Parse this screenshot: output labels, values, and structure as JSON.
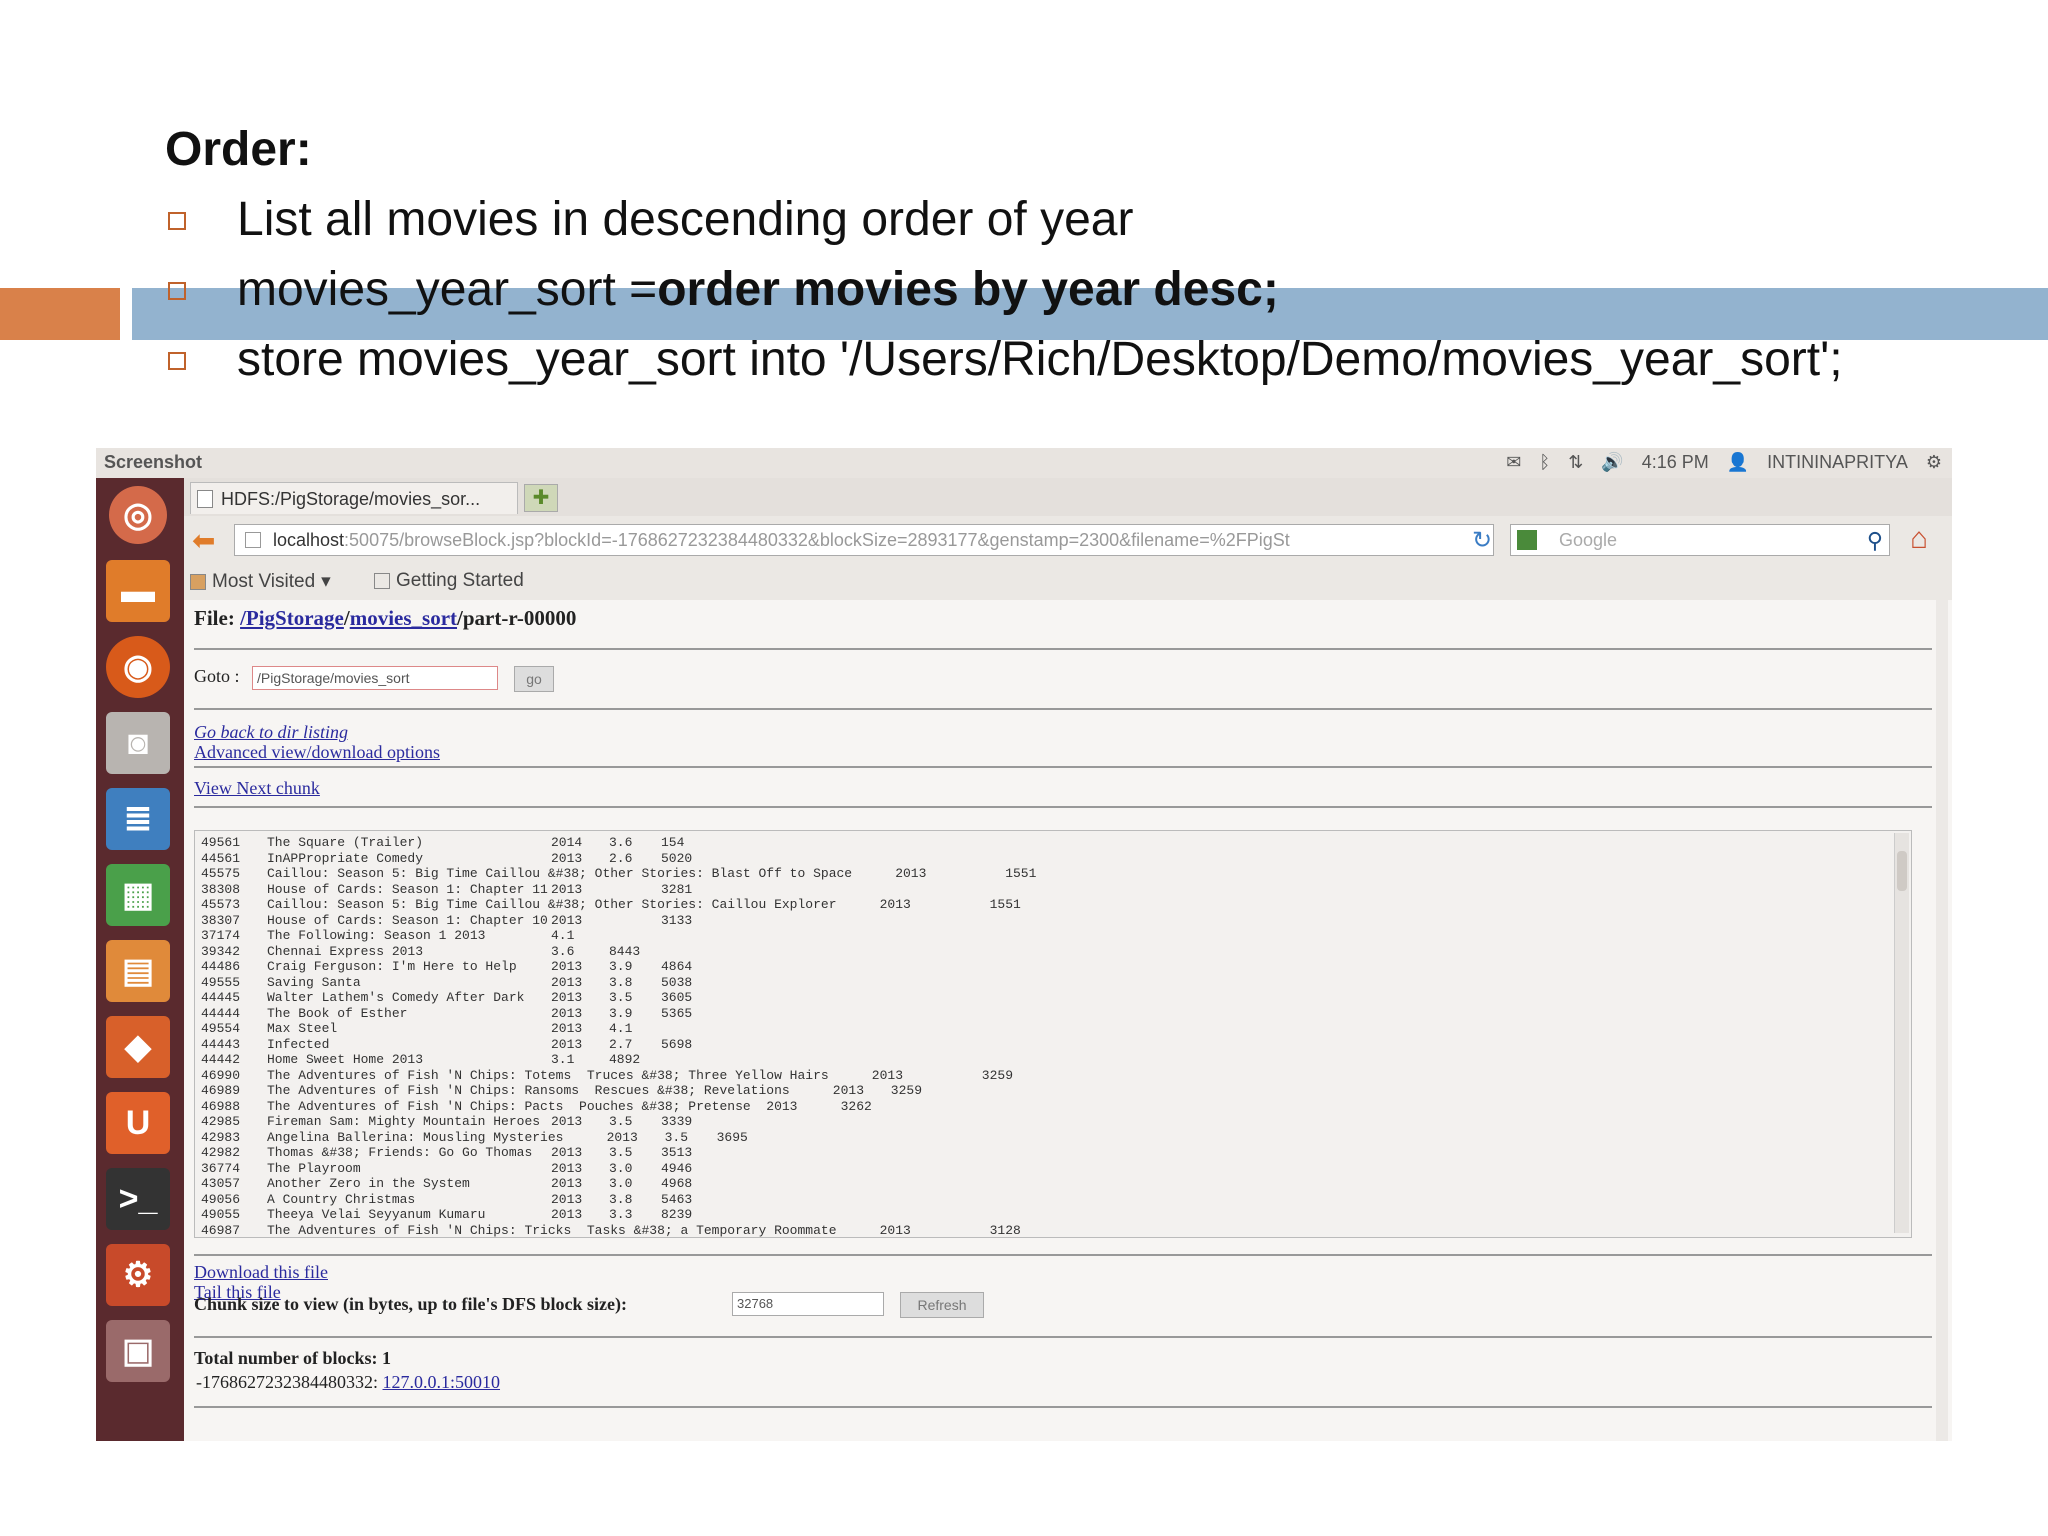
{
  "slide": {
    "heading": "Order:",
    "bullets": [
      {
        "text": "List all movies in descending order of year"
      },
      {
        "prefix": "movies_year_sort =",
        "bold": "order movies by year desc;"
      },
      {
        "text": "store movies_year_sort into '/Users/Rich/Desktop/Demo/movies_year_sort';"
      }
    ]
  },
  "top_panel": {
    "title": "Screenshot",
    "time": "4:16 PM",
    "user": "INTININAPRITYA"
  },
  "browser": {
    "tab_title": "HDFS:/PigStorage/movies_sor...",
    "url_host": "localhost",
    "url_rest": ":50075/browseBlock.jsp?blockId=-1768627232384480332&blockSize=2893177&genstamp=2300&filename=%2FPigSt",
    "search_placeholder": "Google",
    "bookmarks": [
      "Most Visited",
      "Getting Started"
    ]
  },
  "page": {
    "file_label": "File:",
    "file_path_1": "/PigStorage",
    "file_path_sep": "/",
    "file_path_2": "movies_sort",
    "file_name": "/part-r-00000",
    "goto_label": "Goto :",
    "goto_value": "/PigStorage/movies_sort",
    "go_button": "go",
    "link_back": "Go back to dir listing",
    "link_advanced": "Advanced view/download options",
    "link_next": "View Next chunk",
    "link_download": "Download this file",
    "link_tail": "Tail this file",
    "chunk_label": "Chunk size to view (in bytes, up to file's DFS block size):",
    "chunk_value": "32768",
    "refresh_button": "Refresh",
    "total_blocks": "Total number of blocks: 1",
    "block_id": "-1768627232384480332:",
    "block_link": "127.0.0.1:50010"
  },
  "rows": [
    [
      "49561",
      "The Square (Trailer)",
      "2014",
      "3.6",
      "154"
    ],
    [
      "44561",
      "InAPPropriate Comedy",
      "2013",
      "2.6",
      "5020"
    ],
    [
      "45575",
      "Caillou: Season 5: Big Time Caillou &#38; Other Stories: Blast Off to Space",
      "2013",
      "",
      "1551"
    ],
    [
      "38308",
      "House of Cards: Season 1: Chapter 11",
      "2013",
      "",
      "3281"
    ],
    [
      "45573",
      "Caillou: Season 5: Big Time Caillou &#38; Other Stories: Caillou Explorer",
      "2013",
      "",
      "1551"
    ],
    [
      "38307",
      "House of Cards: Season 1: Chapter 10",
      "2013",
      "",
      "3133"
    ],
    [
      "37174",
      "The Following: Season 1 2013",
      "4.1",
      "",
      ""
    ],
    [
      "39342",
      "Chennai Express 2013",
      "3.6",
      "8443",
      ""
    ],
    [
      "44486",
      "Craig Ferguson: I'm Here to Help",
      "2013",
      "3.9",
      "4864"
    ],
    [
      "49555",
      "Saving Santa",
      "2013",
      "3.8",
      "5038"
    ],
    [
      "44445",
      "Walter Lathem's Comedy After Dark",
      "2013",
      "3.5",
      "3605"
    ],
    [
      "44444",
      "The Book of Esther",
      "2013",
      "3.9",
      "5365"
    ],
    [
      "49554",
      "Max Steel",
      "2013",
      "4.1",
      ""
    ],
    [
      "44443",
      "Infected",
      "2013",
      "2.7",
      "5698"
    ],
    [
      "44442",
      "Home Sweet Home 2013",
      "3.1",
      "4892",
      ""
    ],
    [
      "46990",
      "The Adventures of Fish 'N Chips: Totems  Truces &#38; Three Yellow Hairs",
      "2013",
      "",
      "3259"
    ],
    [
      "46989",
      "The Adventures of Fish 'N Chips: Ransoms  Rescues &#38; Revelations",
      "2013",
      "3259",
      ""
    ],
    [
      "46988",
      "The Adventures of Fish 'N Chips: Pacts  Pouches &#38; Pretense  2013",
      "3262",
      "",
      ""
    ],
    [
      "42985",
      "Fireman Sam: Mighty Mountain Heroes",
      "2013",
      "3.5",
      "3339"
    ],
    [
      "42983",
      "Angelina Ballerina: Mousling Mysteries",
      "2013",
      "3.5",
      "3695"
    ],
    [
      "42982",
      "Thomas &#38; Friends: Go Go Thomas",
      "2013",
      "3.5",
      "3513"
    ],
    [
      "36774",
      "The Playroom",
      "2013",
      "3.0",
      "4946"
    ],
    [
      "43057",
      "Another Zero in the System",
      "2013",
      "3.0",
      "4968"
    ],
    [
      "49056",
      "A Country Christmas",
      "2013",
      "3.8",
      "5463"
    ],
    [
      "49055",
      "Theeya Velai Seyyanum Kumaru",
      "2013",
      "3.3",
      "8239"
    ],
    [
      "46987",
      "The Adventures of Fish 'N Chips: Tricks  Tasks &#38; a Temporary Roommate",
      "2013",
      "",
      "3128"
    ]
  ]
}
